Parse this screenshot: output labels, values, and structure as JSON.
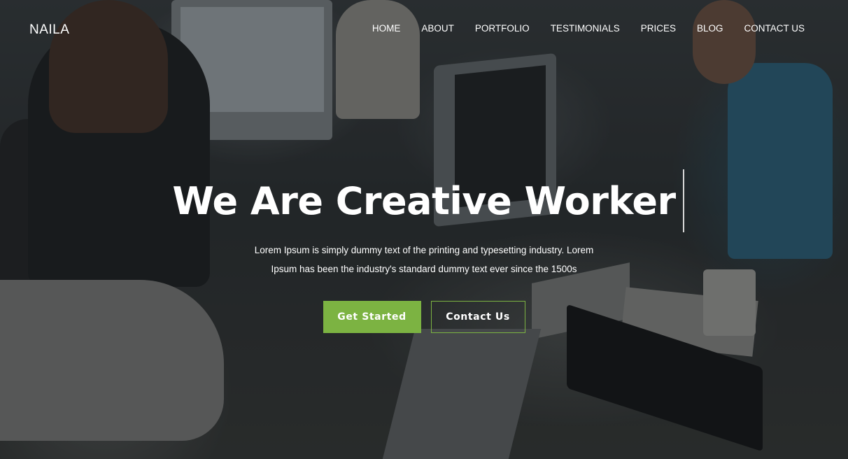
{
  "brand": {
    "logo": "NAILA"
  },
  "nav": {
    "items": [
      {
        "label": "HOME"
      },
      {
        "label": "ABOUT"
      },
      {
        "label": "PORTFOLIO"
      },
      {
        "label": "TESTIMONIALS"
      },
      {
        "label": "PRICES"
      },
      {
        "label": "BLOG"
      },
      {
        "label": "CONTACT US"
      }
    ]
  },
  "hero": {
    "headline": "We Are Creative Worker",
    "subtitle_line1": "Lorem Ipsum is simply dummy text of the printing and typesetting industry. Lorem",
    "subtitle_line2": "Ipsum has been the industry's standard dummy text ever since the 1500s",
    "primary_button": "Get Started",
    "secondary_button": "Contact Us",
    "background_image": "office-workers-photo"
  },
  "colors": {
    "accent": "#7cb342",
    "text": "#ffffff"
  }
}
